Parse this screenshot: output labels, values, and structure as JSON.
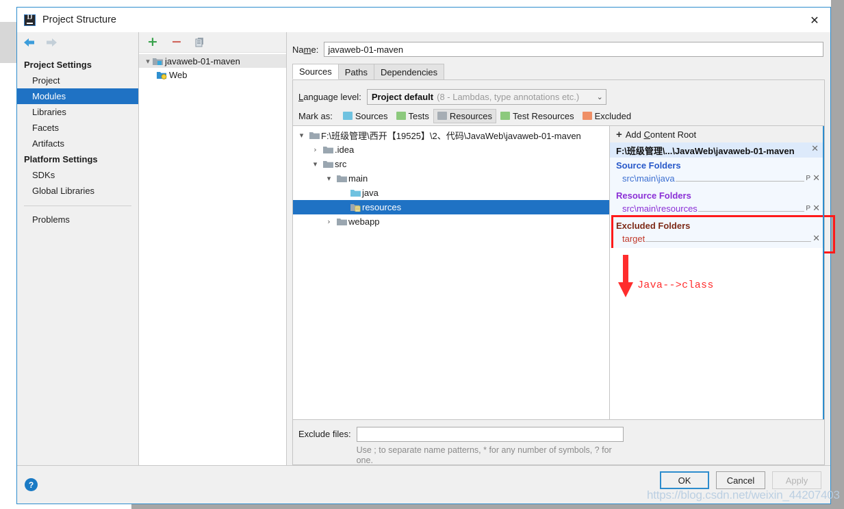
{
  "window": {
    "title": "Project Structure",
    "app_icon": "intellij-idea-icon",
    "close_icon": "✕"
  },
  "sidebar": {
    "nav": {
      "back_icon": "➡",
      "forward_icon": "➡"
    },
    "groups": [
      {
        "label": "Project Settings",
        "items": [
          {
            "label": "Project",
            "selected": false
          },
          {
            "label": "Modules",
            "selected": true
          },
          {
            "label": "Libraries",
            "selected": false
          },
          {
            "label": "Facets",
            "selected": false
          },
          {
            "label": "Artifacts",
            "selected": false
          }
        ]
      },
      {
        "label": "Platform Settings",
        "items": [
          {
            "label": "SDKs",
            "selected": false
          },
          {
            "label": "Global Libraries",
            "selected": false
          }
        ]
      }
    ],
    "problems": {
      "label": "Problems"
    }
  },
  "modules": {
    "toolbar": {
      "add_label": "+",
      "remove_label": "−",
      "copy_label": "copy-icon"
    },
    "tree": [
      {
        "label": "javaweb-01-maven",
        "indent": 0,
        "chevron": "▾",
        "icon": "module-folder-icon",
        "highlighted": true
      },
      {
        "label": "Web",
        "indent": 1,
        "chevron": "",
        "icon": "web-facet-icon",
        "highlighted": false
      }
    ]
  },
  "main": {
    "name_label": "Name:",
    "name_value": "javaweb-01-maven",
    "tabs": [
      {
        "label": "Sources",
        "active": true
      },
      {
        "label": "Paths",
        "active": false
      },
      {
        "label": "Dependencies",
        "active": false
      }
    ],
    "language_level": {
      "label": "Language level:",
      "selected": "Project default",
      "hint": "(8 - Lambdas, type annotations etc.)",
      "chevron": "⌄"
    },
    "mark_as": {
      "label": "Mark as:",
      "options": [
        {
          "label": "Sources",
          "color": "#6fc2e0",
          "active": false
        },
        {
          "label": "Tests",
          "color": "#8cc97d",
          "active": false
        },
        {
          "label": "Resources",
          "color": "#a6adb4",
          "active": true
        },
        {
          "label": "Test Resources",
          "color": "#8cc97d",
          "active": false
        },
        {
          "label": "Excluded",
          "color": "#ef8f66",
          "active": false
        }
      ]
    },
    "file_tree": [
      {
        "label": "F:\\班级管理\\西开【19525】\\2、代码\\JavaWeb\\javaweb-01-maven",
        "indent": 0,
        "chevron": "▾",
        "icon": "folder-gray-icon",
        "selected": false
      },
      {
        "label": ".idea",
        "indent": 1,
        "chevron": "›",
        "icon": "folder-gray-icon",
        "selected": false
      },
      {
        "label": "src",
        "indent": 1,
        "chevron": "▾",
        "icon": "folder-gray-icon",
        "selected": false
      },
      {
        "label": "main",
        "indent": 2,
        "chevron": "▾",
        "icon": "folder-gray-icon",
        "selected": false
      },
      {
        "label": "java",
        "indent": 3,
        "chevron": "",
        "icon": "folder-blue-icon",
        "selected": false
      },
      {
        "label": "resources",
        "indent": 3,
        "chevron": "",
        "icon": "folder-res-icon",
        "selected": true
      },
      {
        "label": "webapp",
        "indent": 2,
        "chevron": "›",
        "icon": "folder-gray-icon",
        "selected": false
      }
    ],
    "exclude_files": {
      "label": "Exclude files:",
      "value": "",
      "hint": "Use ; to separate name patterns, * for any number of symbols, ? for one."
    }
  },
  "content_roots": {
    "add_label": "Add Content Root",
    "add_icon": "plus-icon",
    "root_path": "F:\\班级管理\\...\\JavaWeb\\javaweb-01-maven",
    "root_remove_icon": "✕",
    "sections": [
      {
        "title": "Source Folders",
        "kind": "source",
        "entries": [
          {
            "path": "src\\main\\java",
            "flag": "P",
            "remove_icon": "✕"
          }
        ]
      },
      {
        "title": "Resource Folders",
        "kind": "resource",
        "entries": [
          {
            "path": "src\\main\\resources",
            "flag": "P",
            "remove_icon": "✕"
          }
        ]
      },
      {
        "title": "Excluded Folders",
        "kind": "excluded",
        "highlighted": true,
        "entries": [
          {
            "path": "target",
            "flag": "",
            "remove_icon": "✕"
          }
        ]
      }
    ]
  },
  "annotation": {
    "text": "Java-->class",
    "arrow_icon": "down-arrow-icon",
    "color": "#ff2d2d"
  },
  "footer": {
    "help_icon": "?",
    "buttons": [
      {
        "label": "OK",
        "style": "default"
      },
      {
        "label": "Cancel",
        "style": "normal"
      },
      {
        "label": "Apply",
        "style": "disabled"
      }
    ]
  },
  "watermark": {
    "text": "https://blog.csdn.net/weixin_44207403"
  },
  "colors": {
    "accent": "#1f72c4",
    "highlight_red": "#ff1a1a",
    "source_blue": "#3c6fd1",
    "resource_purple": "#8b2fd6",
    "excluded_red": "#c0392b"
  }
}
